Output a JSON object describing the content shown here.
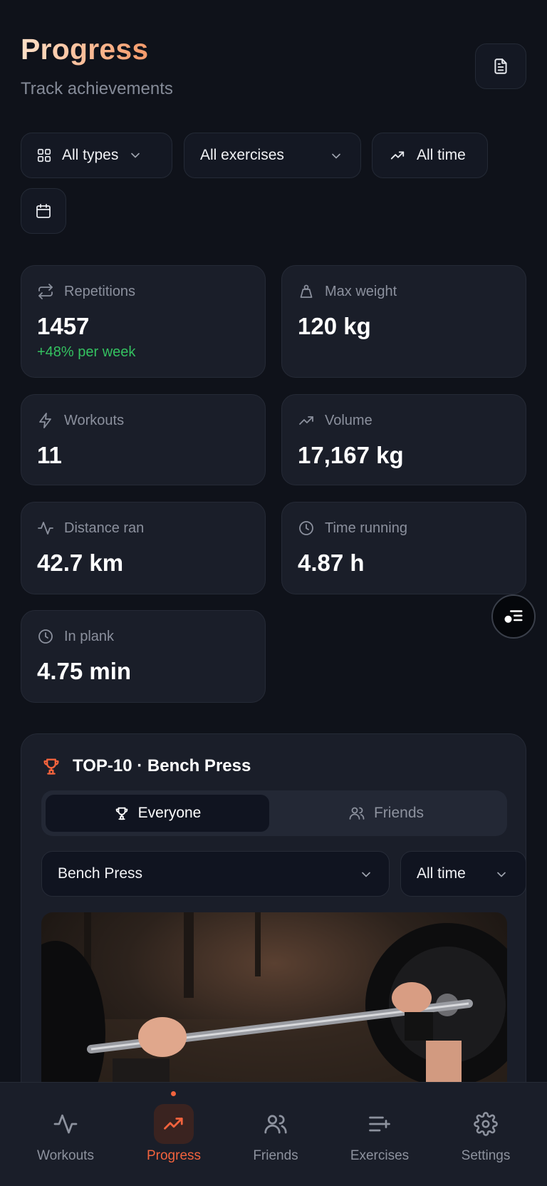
{
  "header": {
    "title": "Progress",
    "subtitle": "Track achievements"
  },
  "filters": {
    "types": "All types",
    "exercises": "All exercises",
    "period": "All time"
  },
  "stats": [
    {
      "label": "Repetitions",
      "value": "1457",
      "delta": "+48% per week",
      "icon": "repeat-icon"
    },
    {
      "label": "Max weight",
      "value": "120 kg",
      "icon": "weight-icon"
    },
    {
      "label": "Workouts",
      "value": "11",
      "icon": "lightning-icon"
    },
    {
      "label": "Volume",
      "value": "17,167 kg",
      "icon": "trend-up-icon"
    },
    {
      "label": "Distance ran",
      "value": "42.7 km",
      "icon": "activity-icon"
    },
    {
      "label": "Time running",
      "value": "4.87 h",
      "icon": "clock-icon"
    },
    {
      "label": "In plank",
      "value": "4.75 min",
      "icon": "clock-icon"
    }
  ],
  "leaderboard": {
    "title": "TOP-10 · Bench Press",
    "tabs": {
      "everyone": "Everyone",
      "friends": "Friends"
    },
    "active_tab": "everyone",
    "exercise": "Bench Press",
    "period": "All time"
  },
  "nav": {
    "items": [
      {
        "label": "Workouts",
        "icon": "activity-icon"
      },
      {
        "label": "Progress",
        "icon": "trend-up-icon"
      },
      {
        "label": "Friends",
        "icon": "users-icon"
      },
      {
        "label": "Exercises",
        "icon": "list-add-icon"
      },
      {
        "label": "Settings",
        "icon": "gear-icon"
      }
    ],
    "active": "Progress"
  },
  "colors": {
    "accent": "#f2633d",
    "positive": "#34c160",
    "background": "#0f121a",
    "card": "#1a1e29"
  }
}
